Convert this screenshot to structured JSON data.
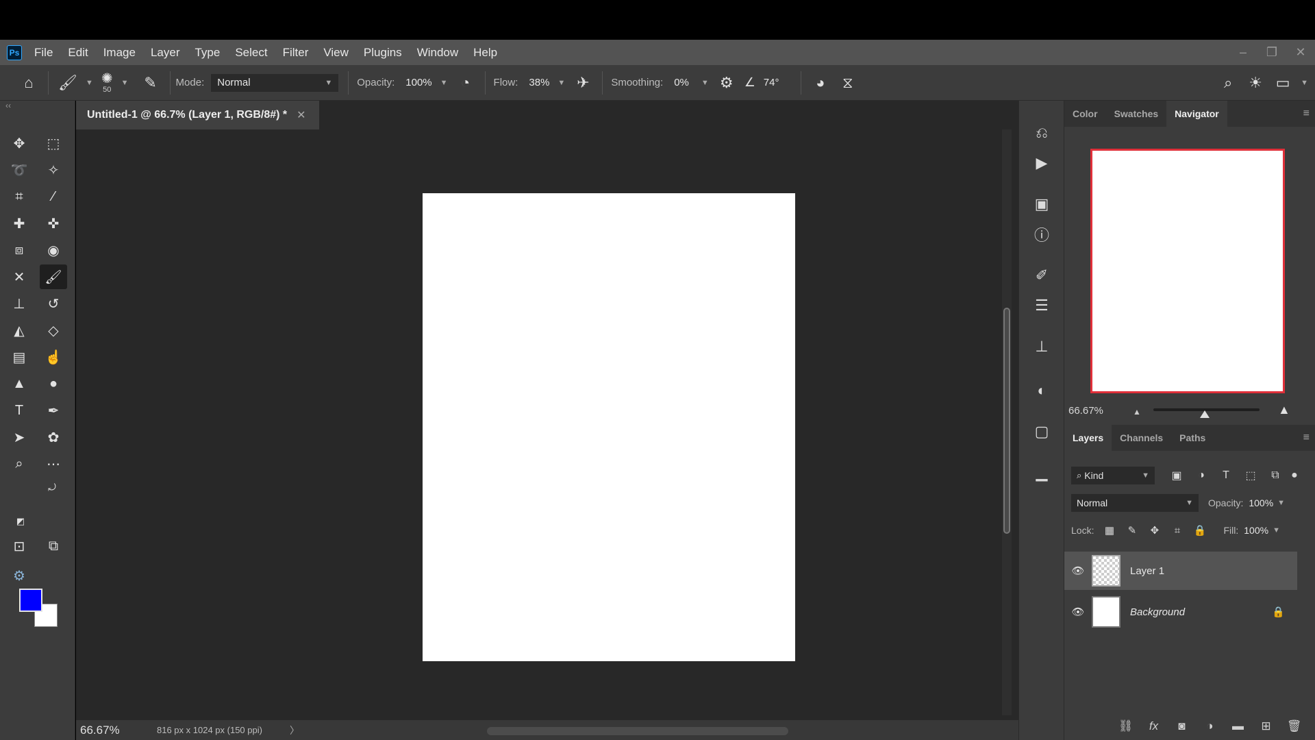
{
  "menu": [
    "File",
    "Edit",
    "Image",
    "Layer",
    "Type",
    "Select",
    "Filter",
    "View",
    "Plugins",
    "Window",
    "Help"
  ],
  "app_logo": "Ps",
  "options": {
    "brush_size": "50",
    "mode_label": "Mode:",
    "mode_value": "Normal",
    "opacity_label": "Opacity:",
    "opacity_value": "100%",
    "flow_label": "Flow:",
    "flow_value": "38%",
    "smoothing_label": "Smoothing:",
    "smoothing_value": "0%",
    "angle_value": "74°"
  },
  "document": {
    "tab_title": "Untitled-1 @ 66.7% (Layer 1, RGB/8#) *",
    "zoom": "66.67%",
    "info": "816 px x 1024 px (150 ppi)"
  },
  "colors": {
    "foreground": "#0000ff",
    "background": "#ffffff",
    "accent": "#31a8ff"
  },
  "top_panel": {
    "tabs": [
      "Color",
      "Swatches",
      "Navigator"
    ],
    "active_tab": "Navigator",
    "zoom": "66.67%"
  },
  "layers_panel": {
    "tabs": [
      "Layers",
      "Channels",
      "Paths"
    ],
    "active_tab": "Layers",
    "filter_kind": "Kind",
    "blend_mode": "Normal",
    "opacity_label": "Opacity:",
    "opacity_value": "100%",
    "lock_label": "Lock:",
    "fill_label": "Fill:",
    "fill_value": "100%",
    "layers": [
      {
        "name": "Layer 1",
        "selected": true,
        "visible": true,
        "locked": false
      },
      {
        "name": "Background",
        "selected": false,
        "visible": true,
        "locked": true
      }
    ]
  }
}
